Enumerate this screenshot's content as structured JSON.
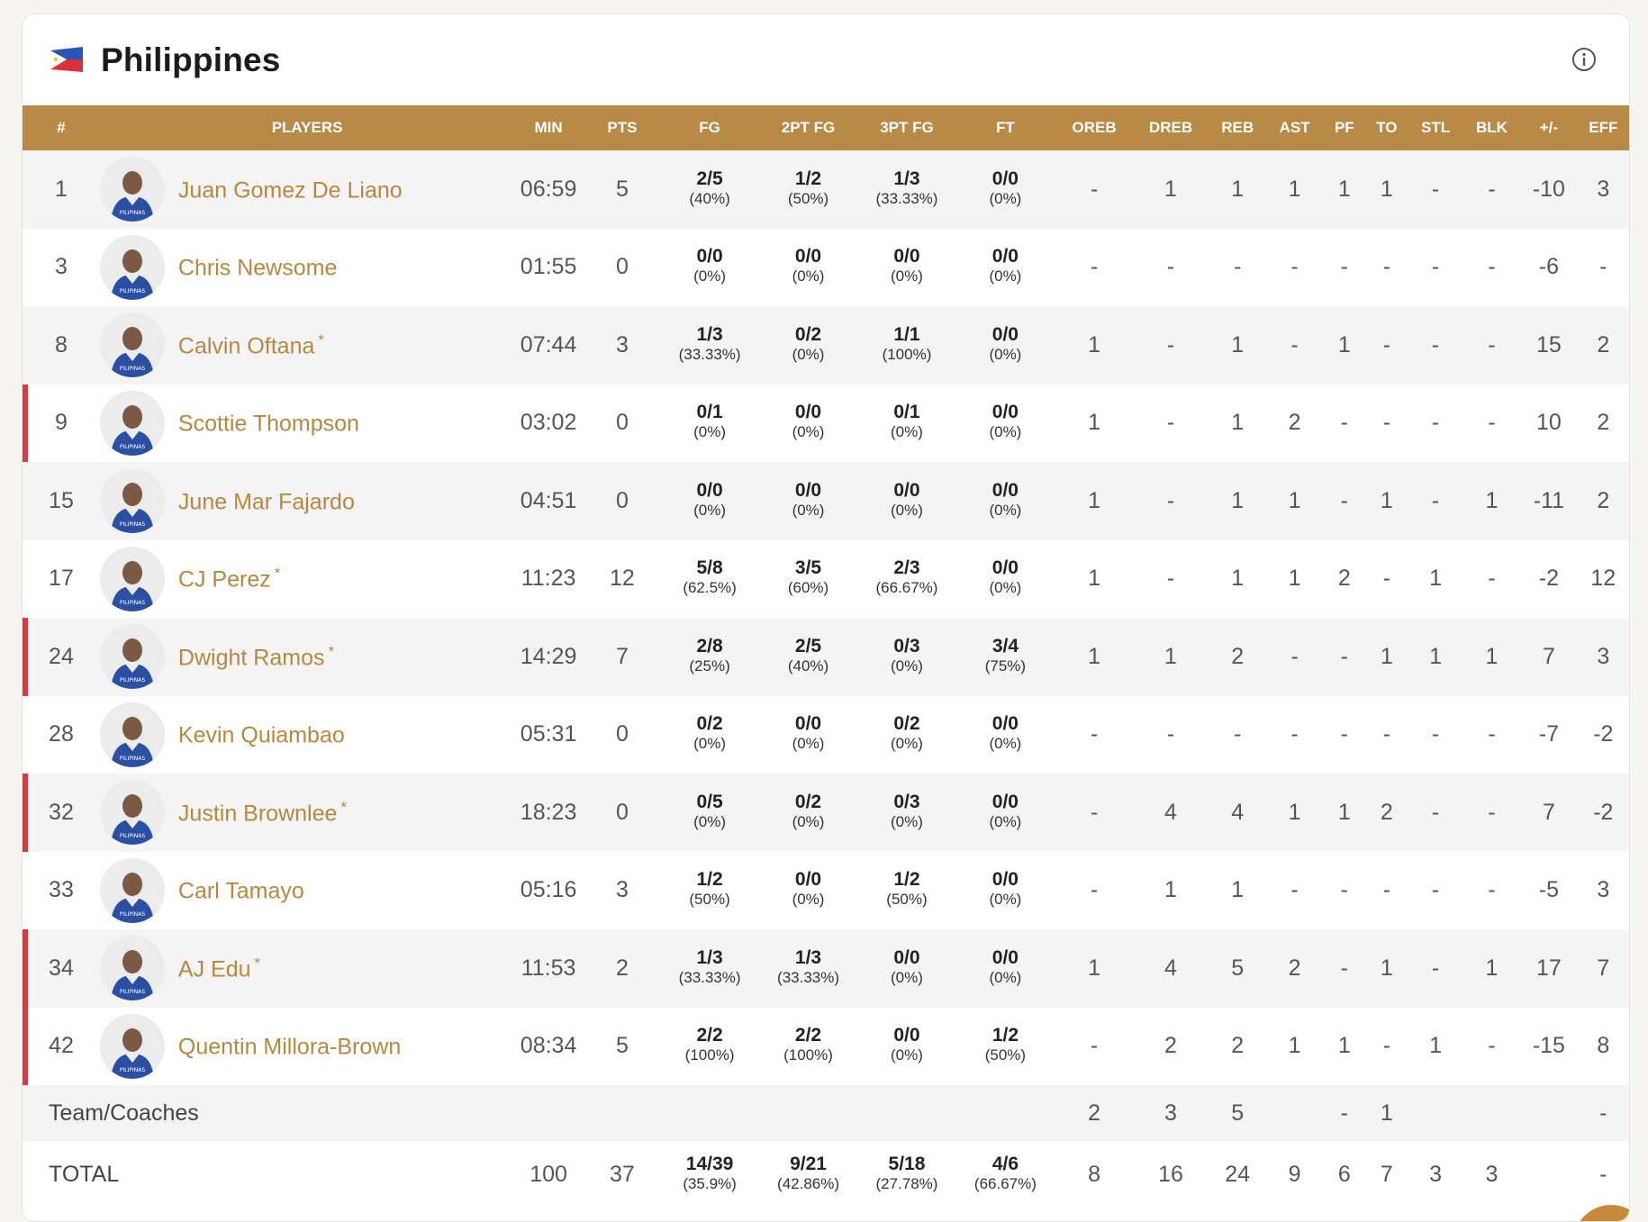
{
  "team": {
    "name": "Philippines"
  },
  "columns": [
    "#",
    "PLAYERS",
    "MIN",
    "PTS",
    "FG",
    "2PT FG",
    "3PT FG",
    "FT",
    "OREB",
    "DREB",
    "REB",
    "AST",
    "PF",
    "TO",
    "STL",
    "BLK",
    "+/-",
    "EFF"
  ],
  "players": [
    {
      "num": "1",
      "name": "Juan Gomez De Liano",
      "star": "",
      "min": "06:59",
      "pts": "5",
      "fg": "2/5",
      "fg_pct": "(40%)",
      "fg2": "1/2",
      "fg2_pct": "(50%)",
      "fg3": "1/3",
      "fg3_pct": "(33.33%)",
      "ft": "0/0",
      "ft_pct": "(0%)",
      "oreb": "-",
      "dreb": "1",
      "reb": "1",
      "ast": "1",
      "pf": "1",
      "to": "1",
      "stl": "-",
      "blk": "-",
      "pm": "-10",
      "eff": "3"
    },
    {
      "num": "3",
      "name": "Chris Newsome",
      "star": "",
      "min": "01:55",
      "pts": "0",
      "fg": "0/0",
      "fg_pct": "(0%)",
      "fg2": "0/0",
      "fg2_pct": "(0%)",
      "fg3": "0/0",
      "fg3_pct": "(0%)",
      "ft": "0/0",
      "ft_pct": "(0%)",
      "oreb": "-",
      "dreb": "-",
      "reb": "-",
      "ast": "-",
      "pf": "-",
      "to": "-",
      "stl": "-",
      "blk": "-",
      "pm": "-6",
      "eff": "-"
    },
    {
      "num": "8",
      "name": "Calvin Oftana",
      "star": "*",
      "min": "07:44",
      "pts": "3",
      "fg": "1/3",
      "fg_pct": "(33.33%)",
      "fg2": "0/2",
      "fg2_pct": "(0%)",
      "fg3": "1/1",
      "fg3_pct": "(100%)",
      "ft": "0/0",
      "ft_pct": "(0%)",
      "oreb": "1",
      "dreb": "-",
      "reb": "1",
      "ast": "-",
      "pf": "1",
      "to": "-",
      "stl": "-",
      "blk": "-",
      "pm": "15",
      "eff": "2"
    },
    {
      "num": "9",
      "name": "Scottie Thompson",
      "star": "",
      "min": "03:02",
      "pts": "0",
      "fg": "0/1",
      "fg_pct": "(0%)",
      "fg2": "0/0",
      "fg2_pct": "(0%)",
      "fg3": "0/1",
      "fg3_pct": "(0%)",
      "ft": "0/0",
      "ft_pct": "(0%)",
      "oreb": "1",
      "dreb": "-",
      "reb": "1",
      "ast": "2",
      "pf": "-",
      "to": "-",
      "stl": "-",
      "blk": "-",
      "pm": "10",
      "eff": "2"
    },
    {
      "num": "15",
      "name": "June Mar Fajardo",
      "star": "",
      "min": "04:51",
      "pts": "0",
      "fg": "0/0",
      "fg_pct": "(0%)",
      "fg2": "0/0",
      "fg2_pct": "(0%)",
      "fg3": "0/0",
      "fg3_pct": "(0%)",
      "ft": "0/0",
      "ft_pct": "(0%)",
      "oreb": "1",
      "dreb": "-",
      "reb": "1",
      "ast": "1",
      "pf": "-",
      "to": "1",
      "stl": "-",
      "blk": "1",
      "pm": "-11",
      "eff": "2"
    },
    {
      "num": "17",
      "name": "CJ Perez",
      "star": "*",
      "min": "11:23",
      "pts": "12",
      "fg": "5/8",
      "fg_pct": "(62.5%)",
      "fg2": "3/5",
      "fg2_pct": "(60%)",
      "fg3": "2/3",
      "fg3_pct": "(66.67%)",
      "ft": "0/0",
      "ft_pct": "(0%)",
      "oreb": "1",
      "dreb": "-",
      "reb": "1",
      "ast": "1",
      "pf": "2",
      "to": "-",
      "stl": "1",
      "blk": "-",
      "pm": "-2",
      "eff": "12"
    },
    {
      "num": "24",
      "name": "Dwight Ramos",
      "star": "*",
      "min": "14:29",
      "pts": "7",
      "fg": "2/8",
      "fg_pct": "(25%)",
      "fg2": "2/5",
      "fg2_pct": "(40%)",
      "fg3": "0/3",
      "fg3_pct": "(0%)",
      "ft": "3/4",
      "ft_pct": "(75%)",
      "oreb": "1",
      "dreb": "1",
      "reb": "2",
      "ast": "-",
      "pf": "-",
      "to": "1",
      "stl": "1",
      "blk": "1",
      "pm": "7",
      "eff": "3"
    },
    {
      "num": "28",
      "name": "Kevin Quiambao",
      "star": "",
      "min": "05:31",
      "pts": "0",
      "fg": "0/2",
      "fg_pct": "(0%)",
      "fg2": "0/0",
      "fg2_pct": "(0%)",
      "fg3": "0/2",
      "fg3_pct": "(0%)",
      "ft": "0/0",
      "ft_pct": "(0%)",
      "oreb": "-",
      "dreb": "-",
      "reb": "-",
      "ast": "-",
      "pf": "-",
      "to": "-",
      "stl": "-",
      "blk": "-",
      "pm": "-7",
      "eff": "-2"
    },
    {
      "num": "32",
      "name": "Justin Brownlee",
      "star": "*",
      "min": "18:23",
      "pts": "0",
      "fg": "0/5",
      "fg_pct": "(0%)",
      "fg2": "0/2",
      "fg2_pct": "(0%)",
      "fg3": "0/3",
      "fg3_pct": "(0%)",
      "ft": "0/0",
      "ft_pct": "(0%)",
      "oreb": "-",
      "dreb": "4",
      "reb": "4",
      "ast": "1",
      "pf": "1",
      "to": "2",
      "stl": "-",
      "blk": "-",
      "pm": "7",
      "eff": "-2"
    },
    {
      "num": "33",
      "name": "Carl Tamayo",
      "star": "",
      "min": "05:16",
      "pts": "3",
      "fg": "1/2",
      "fg_pct": "(50%)",
      "fg2": "0/0",
      "fg2_pct": "(0%)",
      "fg3": "1/2",
      "fg3_pct": "(50%)",
      "ft": "0/0",
      "ft_pct": "(0%)",
      "oreb": "-",
      "dreb": "1",
      "reb": "1",
      "ast": "-",
      "pf": "-",
      "to": "-",
      "stl": "-",
      "blk": "-",
      "pm": "-5",
      "eff": "3"
    },
    {
      "num": "34",
      "name": "AJ Edu",
      "star": "*",
      "min": "11:53",
      "pts": "2",
      "fg": "1/3",
      "fg_pct": "(33.33%)",
      "fg2": "1/3",
      "fg2_pct": "(33.33%)",
      "fg3": "0/0",
      "fg3_pct": "(0%)",
      "ft": "0/0",
      "ft_pct": "(0%)",
      "oreb": "1",
      "dreb": "4",
      "reb": "5",
      "ast": "2",
      "pf": "-",
      "to": "1",
      "stl": "-",
      "blk": "1",
      "pm": "17",
      "eff": "7"
    },
    {
      "num": "42",
      "name": "Quentin Millora-Brown",
      "star": "",
      "min": "08:34",
      "pts": "5",
      "fg": "2/2",
      "fg_pct": "(100%)",
      "fg2": "2/2",
      "fg2_pct": "(100%)",
      "fg3": "0/0",
      "fg3_pct": "(0%)",
      "ft": "1/2",
      "ft_pct": "(50%)",
      "oreb": "-",
      "dreb": "2",
      "reb": "2",
      "ast": "1",
      "pf": "1",
      "to": "-",
      "stl": "1",
      "blk": "-",
      "pm": "-15",
      "eff": "8"
    }
  ],
  "oncourt_markers": [
    false,
    false,
    false,
    true,
    false,
    false,
    true,
    false,
    true,
    false,
    true,
    true
  ],
  "team_coaches": {
    "label": "Team/Coaches",
    "oreb": "2",
    "dreb": "3",
    "reb": "5",
    "pf": "-",
    "to": "1",
    "eff": "-"
  },
  "total": {
    "label": "TOTAL",
    "min": "100",
    "pts": "37",
    "fg": "14/39",
    "fg_pct": "(35.9%)",
    "fg2": "9/21",
    "fg2_pct": "(42.86%)",
    "fg3": "5/18",
    "fg3_pct": "(27.78%)",
    "ft": "4/6",
    "ft_pct": "(66.67%)",
    "oreb": "8",
    "dreb": "16",
    "reb": "24",
    "ast": "9",
    "pf": "6",
    "to": "7",
    "stl": "3",
    "blk": "3",
    "eff": "-"
  },
  "colors": {
    "header_bg": "#b88a45",
    "name_text": "#b8873e",
    "oncourt_marker": "#e03843",
    "jersey": "#2b4fa3"
  },
  "icons": {
    "flag": "philippines-flag-icon",
    "info": "info-icon",
    "avatar": "player-avatar"
  }
}
